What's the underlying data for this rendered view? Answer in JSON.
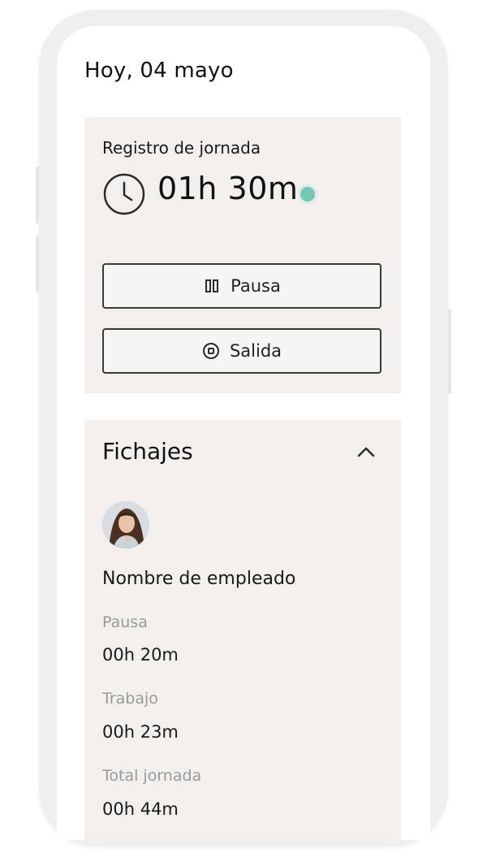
{
  "header": {
    "date": "Hoy, 04 mayo"
  },
  "workday": {
    "title": "Registro de jornada",
    "elapsed": "01h 30m",
    "status_color": "#73c9b4",
    "pause_label": "Pausa",
    "pause_icon": "pause-icon",
    "exit_label": "Salida",
    "exit_icon": "stop-icon"
  },
  "fichajes": {
    "title": "Fichajes",
    "toggle_icon": "chevron-up-icon",
    "employee": {
      "name": "Nombre de empleado",
      "avatar_icon": "avatar"
    },
    "stats": [
      {
        "label": "Pausa",
        "value": "00h 20m"
      },
      {
        "label": "Trabajo",
        "value": "00h 23m"
      },
      {
        "label": "Total jornada",
        "value": "00h 44m"
      }
    ]
  }
}
